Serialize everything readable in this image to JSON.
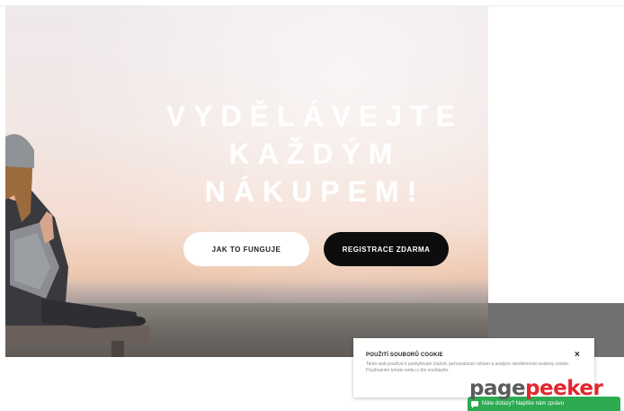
{
  "hero": {
    "headline_lines": [
      "VYDĚLÁVEJTE",
      "KAŽDÝM",
      "NÁKUPEM!"
    ],
    "how_it_works_label": "JAK TO FUNGUJE",
    "register_label": "REGISTRACE ZDARMA"
  },
  "cookie_banner": {
    "title": "POUŽITÍ SOUBORŮ COOKIE",
    "close_label": "×",
    "text": "Tento web používá k poskytování služeb, personalizaci reklam a analýze návštěvnosti soubory cookie. Používáním tohoto webu s tím souhlasíte."
  },
  "chat": {
    "label": "Máte dotazy? Napište nám zprávu",
    "icon": "chat-icon"
  },
  "watermark": {
    "part1": "page",
    "part2": "peeker"
  },
  "colors": {
    "register_button": "#0d0d0d",
    "chat_bar": "#2daa52",
    "watermark_red": "#e3262d"
  }
}
